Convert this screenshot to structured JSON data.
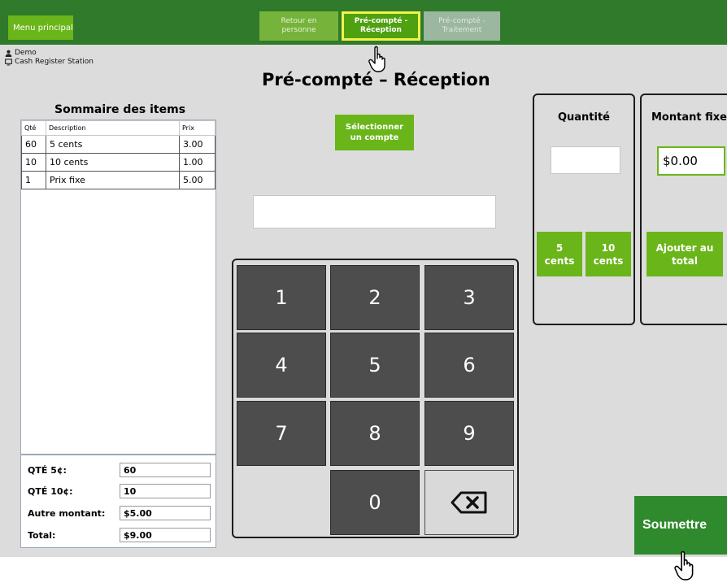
{
  "topbar": {
    "menu_label": "Menu principal",
    "tabs": [
      {
        "line1": "Retour en",
        "line2": "personne"
      },
      {
        "line1": "Pré-compté -",
        "line2": "Réception"
      },
      {
        "line1": "Pré-compté -",
        "line2": "Traitement"
      }
    ]
  },
  "user": {
    "name": "Demo",
    "station": "Cash Register Station"
  },
  "page_title": "Pré-compté – Réception",
  "summary": {
    "title": "Sommaire des items",
    "headers": {
      "qty": "Qté",
      "desc": "Description",
      "price": "Prix"
    },
    "rows": [
      {
        "qty": "60",
        "desc": "5 cents",
        "price": "3.00"
      },
      {
        "qty": "10",
        "desc": "10 cents",
        "price": "1.00"
      },
      {
        "qty": "1",
        "desc": "Prix fixe",
        "price": "5.00"
      }
    ]
  },
  "totals": {
    "qty5_label": "QTÉ 5¢:",
    "qty5_value": "60",
    "qty10_label": "QTÉ 10¢:",
    "qty10_value": "10",
    "other_label": "Autre montant:",
    "other_value": "$5.00",
    "total_label": "Total:",
    "total_value": "$9.00"
  },
  "select_account": {
    "line1": "Sélectionner",
    "line2": "un compte"
  },
  "keypad": {
    "keys": [
      "1",
      "2",
      "3",
      "4",
      "5",
      "6",
      "7",
      "8",
      "9",
      "0"
    ]
  },
  "quantity_panel": {
    "title": "Quantité",
    "btn5": {
      "line1": "5",
      "line2": "cents"
    },
    "btn10": {
      "line1": "10",
      "line2": "cents"
    }
  },
  "fixed_panel": {
    "title": "Montant fixe",
    "value": "$0.00",
    "add_btn": {
      "line1": "Ajouter au",
      "line2": "total"
    }
  },
  "submit_label": "Soumettre",
  "icons": {
    "user": "user-icon",
    "monitor": "monitor-icon",
    "backspace": "backspace-icon",
    "cursor": "hand-cursor-icon"
  },
  "colors": {
    "topbar": "#2f7a2b",
    "accent": "#6ab519",
    "submit": "#2f8a2d",
    "key": "#4d4d4d",
    "highlight": "#f2f24a"
  }
}
